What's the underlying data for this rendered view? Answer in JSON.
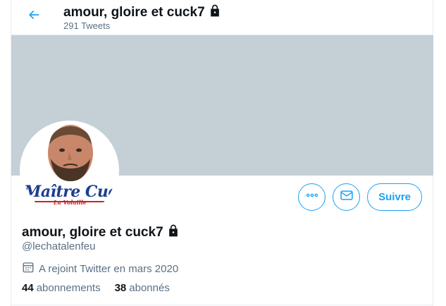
{
  "header": {
    "title": "amour, gloire et cuck7",
    "tweet_count": "291 Tweets",
    "back_icon": "arrow-left-icon",
    "lock_icon": "lock-icon"
  },
  "avatar": {
    "logo_text": "Maître Cuck",
    "logo_sub": "La Volaille"
  },
  "actions": {
    "more_icon": "more-icon",
    "message_icon": "envelope-icon",
    "follow_label": "Suivre"
  },
  "profile": {
    "name": "amour, gloire et cuck7",
    "handle": "@lechatalenfeu",
    "joined": "A rejoint Twitter en mars 2020",
    "calendar_icon": "calendar-icon",
    "following_count": "44",
    "following_label": "abonnements",
    "followers_count": "38",
    "followers_label": "abonnés"
  },
  "colors": {
    "accent": "#1da1f2",
    "banner": "#c4cfd6",
    "secondary_text": "#5b7083"
  }
}
